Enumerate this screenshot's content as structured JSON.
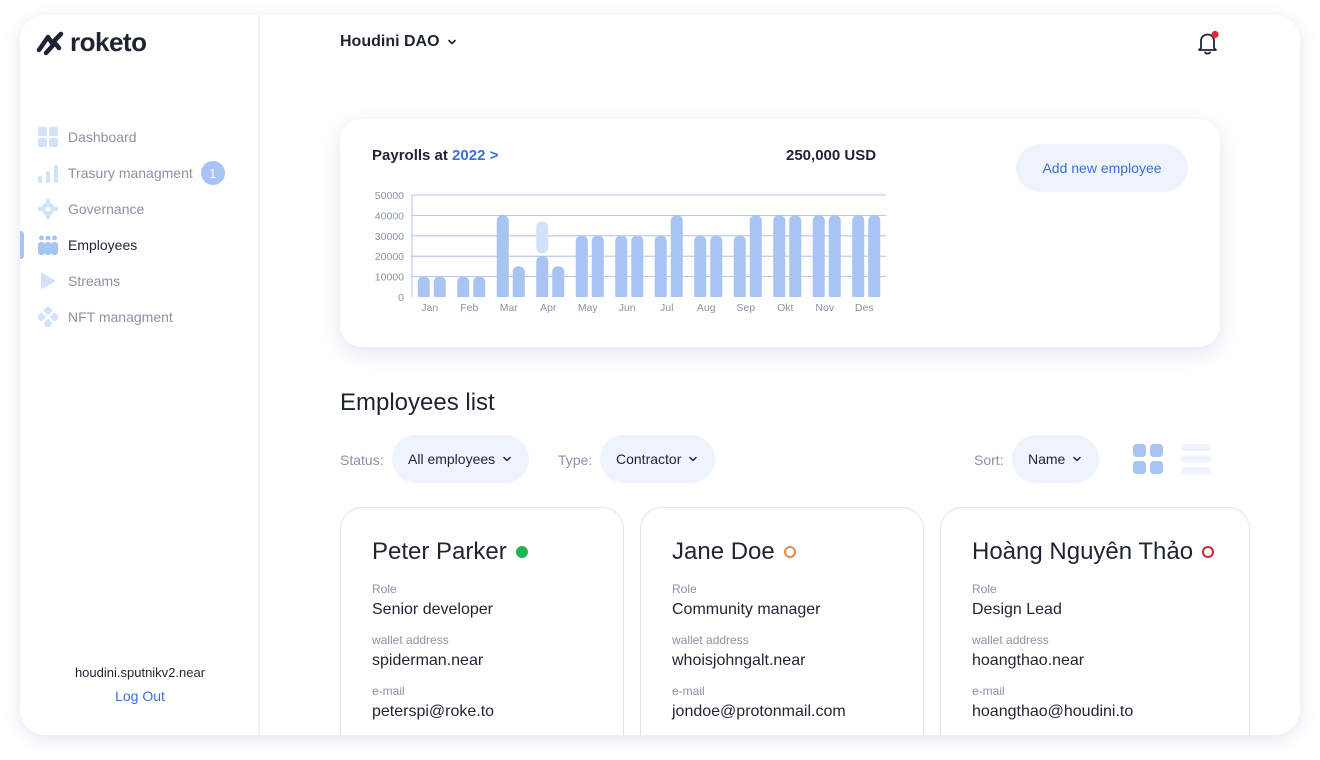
{
  "brand": {
    "name": "roketo"
  },
  "nav": [
    {
      "label": "Dashboard",
      "icon": "grid-icon",
      "active": false
    },
    {
      "label": "Trasury managment",
      "icon": "bar-chart-icon",
      "active": false,
      "badge": "1"
    },
    {
      "label": "Governance",
      "icon": "gear-icon",
      "active": false
    },
    {
      "label": "Employees",
      "icon": "people-icon",
      "active": true
    },
    {
      "label": "Streams",
      "icon": "play-icon",
      "active": false
    },
    {
      "label": "NFT managment",
      "icon": "diamond-icon",
      "active": false
    }
  ],
  "account": {
    "name": "houdini.sputnikv2.near",
    "logout": "Log Out"
  },
  "header": {
    "org": "Houdini DAO"
  },
  "payroll": {
    "title_prefix": "Payrolls at",
    "year_link": "2022 >",
    "total": "250,000 USD",
    "add_button": "Add new employee"
  },
  "chart_data": {
    "type": "bar",
    "months": [
      "Jan",
      "Feb",
      "Mar",
      "Apr",
      "May",
      "Jun",
      "Jul",
      "Aug",
      "Sep",
      "Okt",
      "Nov",
      "Des"
    ],
    "y_ticks": [
      "50000",
      "40000",
      "30000",
      "20000",
      "10000",
      "0"
    ],
    "ylim": [
      0,
      50000
    ],
    "grid": true,
    "bars": [
      {
        "month": "Jan",
        "values": [
          10000,
          10000
        ]
      },
      {
        "month": "Feb",
        "values": [
          10000,
          10000
        ]
      },
      {
        "month": "Mar",
        "values": [
          40000,
          15000
        ]
      },
      {
        "month": "Apr",
        "values": [
          20000,
          15000
        ],
        "stacked_extra": 17000
      },
      {
        "month": "May",
        "values": [
          30000,
          30000
        ]
      },
      {
        "month": "Jun",
        "values": [
          30000,
          30000
        ]
      },
      {
        "month": "Jul",
        "values": [
          30000,
          40000
        ]
      },
      {
        "month": "Aug",
        "values": [
          30000,
          30000
        ]
      },
      {
        "month": "Sep",
        "values": [
          30000,
          40000
        ]
      },
      {
        "month": "Okt",
        "values": [
          40000,
          40000
        ]
      },
      {
        "month": "Nov",
        "values": [
          40000,
          40000
        ]
      },
      {
        "month": "Des",
        "values": [
          40000,
          40000
        ]
      }
    ],
    "colors": {
      "bar": "#a8c4f4",
      "bar_light": "#d3e2fb",
      "grid": "#9fb6e6",
      "label": "#8a92a6"
    }
  },
  "employees_list": {
    "title": "Employees list",
    "status_label": "Status:",
    "status_value": "All employees",
    "type_label": "Type:",
    "type_value": "Contractor",
    "sort_label": "Sort:",
    "sort_value": "Name"
  },
  "employees": [
    {
      "name": "Peter Parker",
      "status_color": "#22b453",
      "status_filled": true,
      "role_label": "Role",
      "role": "Senior developer",
      "wallet_label": "wallet address",
      "wallet": "spiderman.near",
      "email_label": "e-mail",
      "email": "peterspi@roke.to"
    },
    {
      "name": "Jane Doe",
      "status_color": "#e8894a",
      "status_filled": false,
      "role_label": "Role",
      "role": "Community manager",
      "wallet_label": "wallet address",
      "wallet": "whoisjohngalt.near",
      "email_label": "e-mail",
      "email": "jondoe@protonmail.com"
    },
    {
      "name": "Hoàng Nguyên Thảo",
      "status_color": "#d3283a",
      "status_filled": false,
      "role_label": "Role",
      "role": "Design Lead",
      "wallet_label": "wallet address",
      "wallet": "hoangthao.near",
      "email_label": "e-mail",
      "email": "hoangthao@houdini.to"
    }
  ],
  "colors": {
    "accent": "#3a6fe0",
    "accent_soft": "#a8c4f4",
    "pill_bg": "#eef3fd",
    "notification": "#e0243a"
  }
}
